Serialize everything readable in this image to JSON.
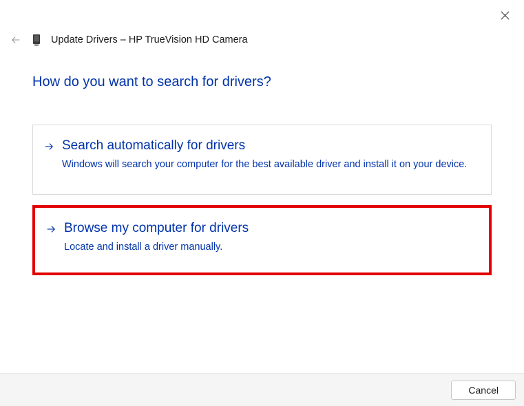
{
  "header": {
    "title": "Update Drivers – HP TrueVision HD Camera"
  },
  "main": {
    "question": "How do you want to search for drivers?",
    "options": [
      {
        "title": "Search automatically for drivers",
        "description": "Windows will search your computer for the best available driver and install it on your device."
      },
      {
        "title": "Browse my computer for drivers",
        "description": "Locate and install a driver manually."
      }
    ]
  },
  "footer": {
    "cancel_label": "Cancel"
  }
}
